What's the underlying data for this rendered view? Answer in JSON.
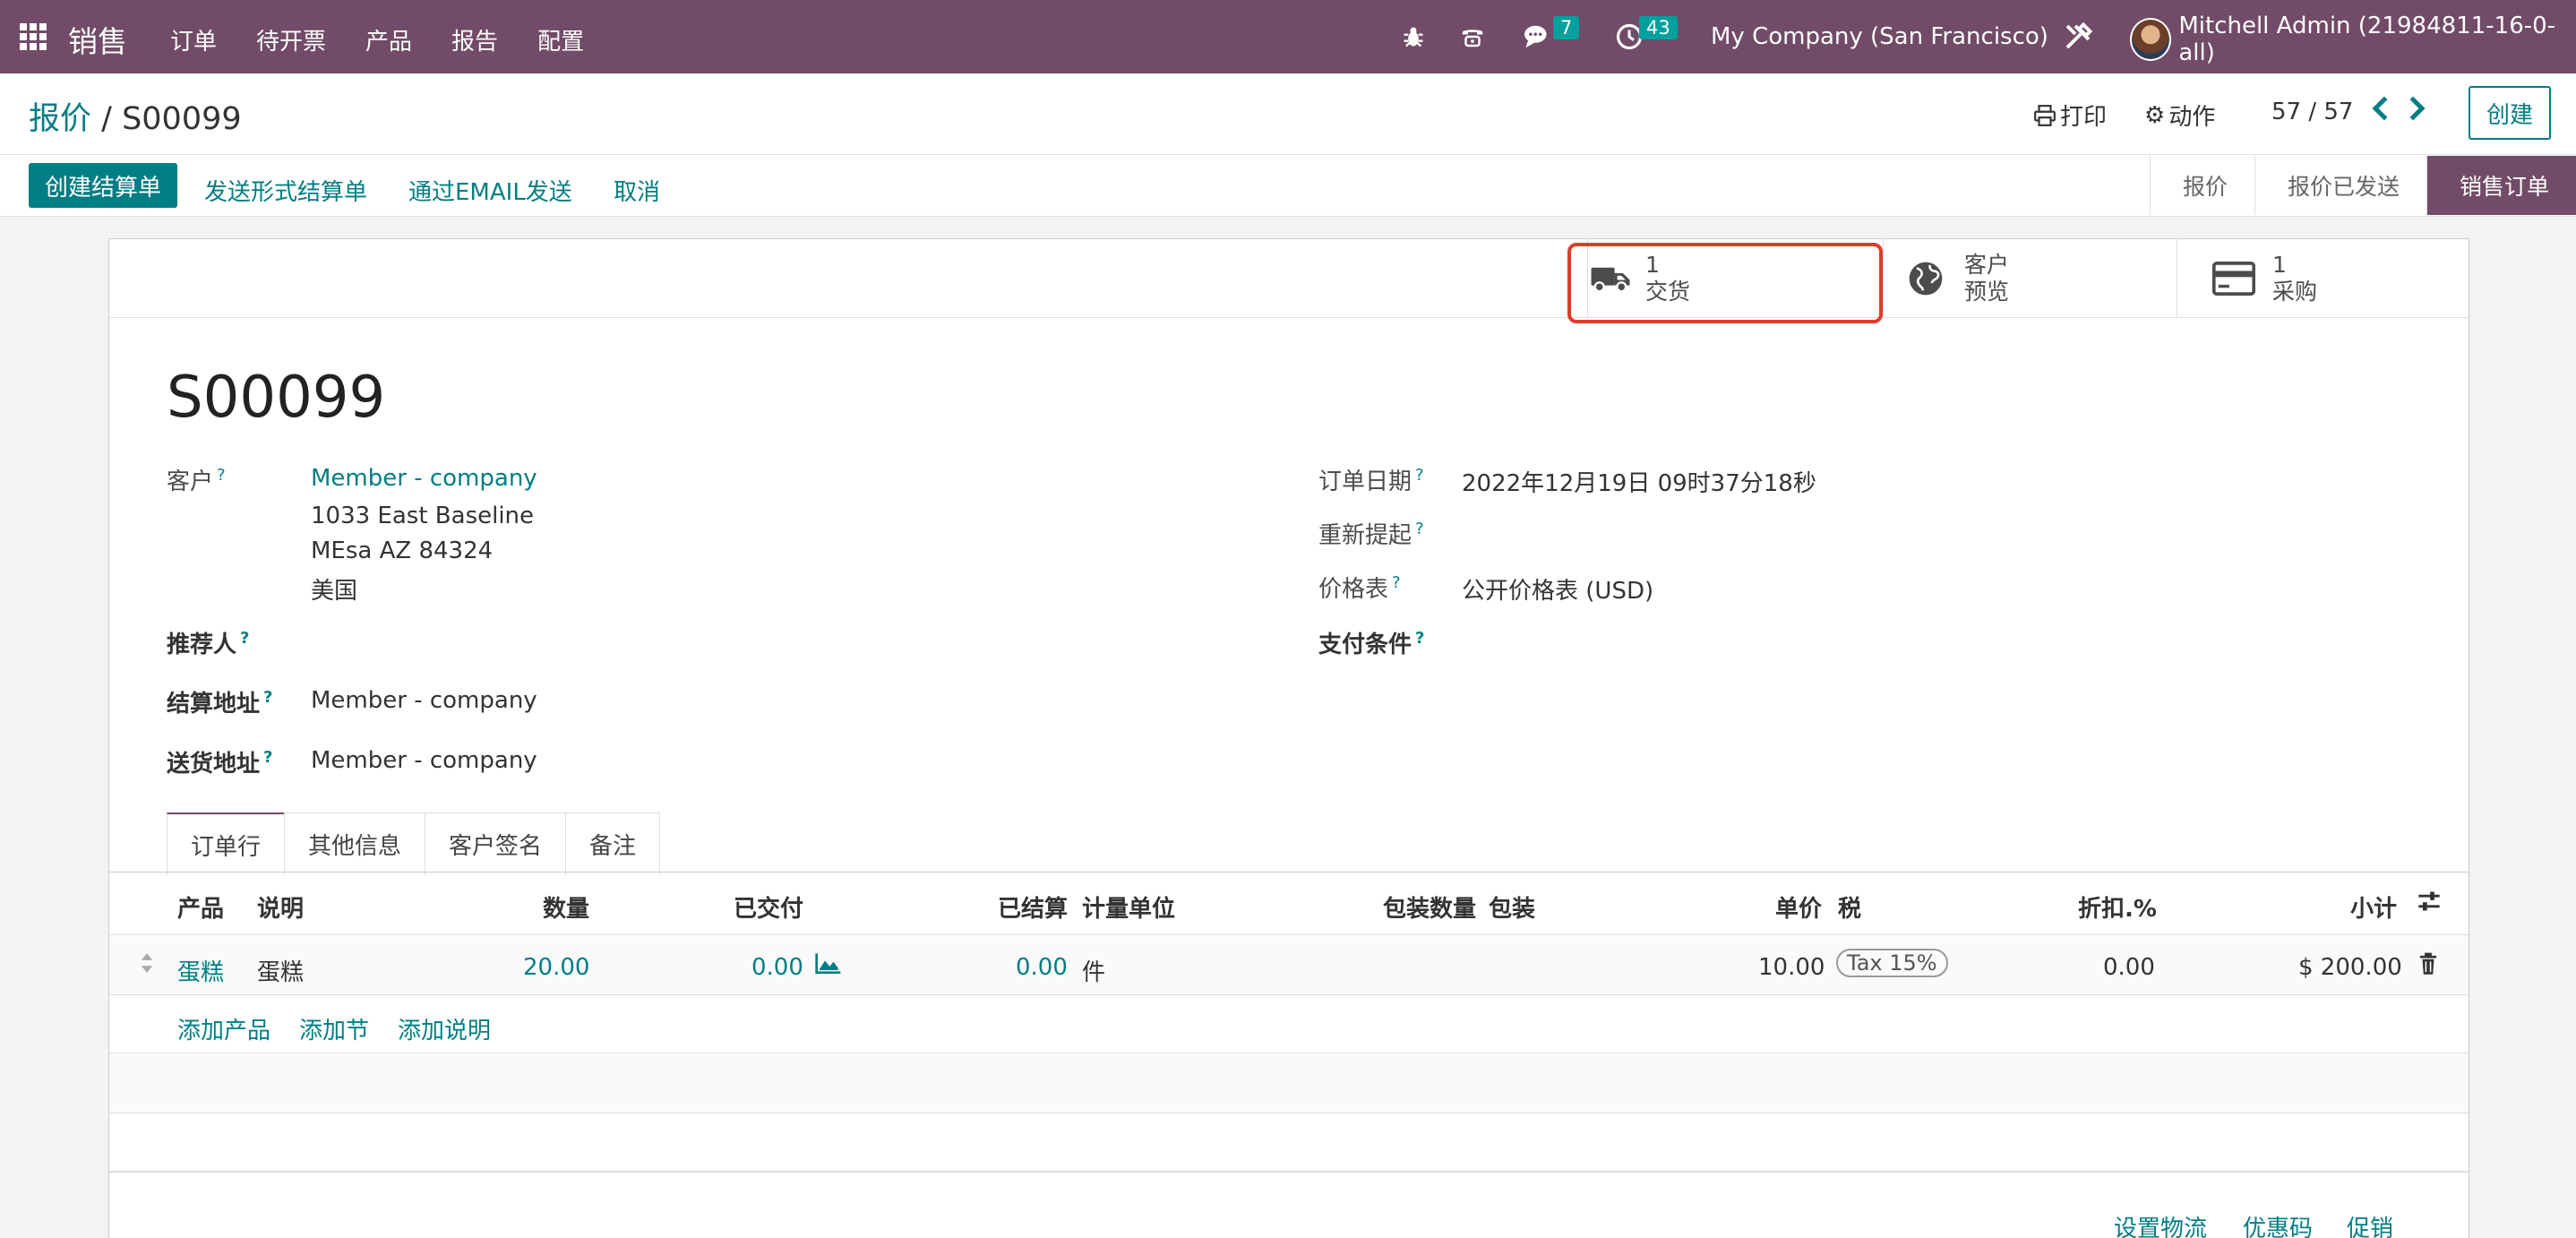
{
  "topbar": {
    "app_name": "销售",
    "menu": [
      "订单",
      "待开票",
      "产品",
      "报告",
      "配置"
    ],
    "messages_count": "7",
    "activities_count": "43",
    "company": "My Company (San Francisco)",
    "user": "Mitchell Admin (21984811-16-0-all)",
    "color": "#714b67"
  },
  "breadcrumb": {
    "parent": "报价",
    "separator": " / ",
    "current": "S00099"
  },
  "toolbar": {
    "print": "打印",
    "action": "动作",
    "pager": "57 / 57",
    "create": "创建"
  },
  "actions": {
    "create_invoice": "创建结算单",
    "send_proforma": "发送形式结算单",
    "send_email": "通过EMAIL发送",
    "cancel": "取消"
  },
  "status": {
    "stages": [
      "报价",
      "报价已发送",
      "销售订单"
    ],
    "active": "销售订单"
  },
  "smart_buttons": [
    {
      "value": "1",
      "label": "交货",
      "icon": "truck-icon"
    },
    {
      "value": "客户",
      "label": "预览",
      "icon": "globe-icon"
    },
    {
      "value": "1",
      "label": "采购",
      "icon": "credit-card-icon"
    }
  ],
  "order": {
    "name": "S00099",
    "customer_label": "客户",
    "customer_name": "Member - company",
    "address_line1": "1033 East Baseline",
    "address_line2": "MEsa AZ 84324",
    "address_line3": "美国",
    "referrer_label": "推荐人",
    "invoice_address_label": "结算地址",
    "invoice_address": "Member - company",
    "delivery_address_label": "送货地址",
    "delivery_address": "Member - company",
    "order_date_label": "订单日期",
    "order_date": "2022年12月19日 09时37分18秒",
    "reminder_label": "重新提起",
    "pricelist_label": "价格表",
    "pricelist": "公开价格表 (USD)",
    "payment_terms_label": "支付条件",
    "help_mark": "?"
  },
  "tabs": [
    "订单行",
    "其他信息",
    "客户签名",
    "备注"
  ],
  "table": {
    "headers": {
      "product": "产品",
      "description": "说明",
      "qty": "数量",
      "delivered": "已交付",
      "invoiced": "已结算",
      "uom": "计量单位",
      "pkg_qty": "包装数量",
      "pkg": "包装",
      "price": "单价",
      "tax": "税",
      "discount": "折扣.%",
      "subtotal": "小计"
    },
    "rows": [
      {
        "product": "蛋糕",
        "description": "蛋糕",
        "qty": "20.00",
        "delivered": "0.00",
        "invoiced": "0.00",
        "uom": "件",
        "price": "10.00",
        "tax": "Tax 15%",
        "discount": "0.00",
        "subtotal": "$ 200.00"
      }
    ],
    "add_product": "添加产品",
    "add_section": "添加节",
    "add_note": "添加说明"
  },
  "footer_links": {
    "shipping": "设置物流",
    "coupon": "优惠码",
    "promotion": "促销"
  }
}
